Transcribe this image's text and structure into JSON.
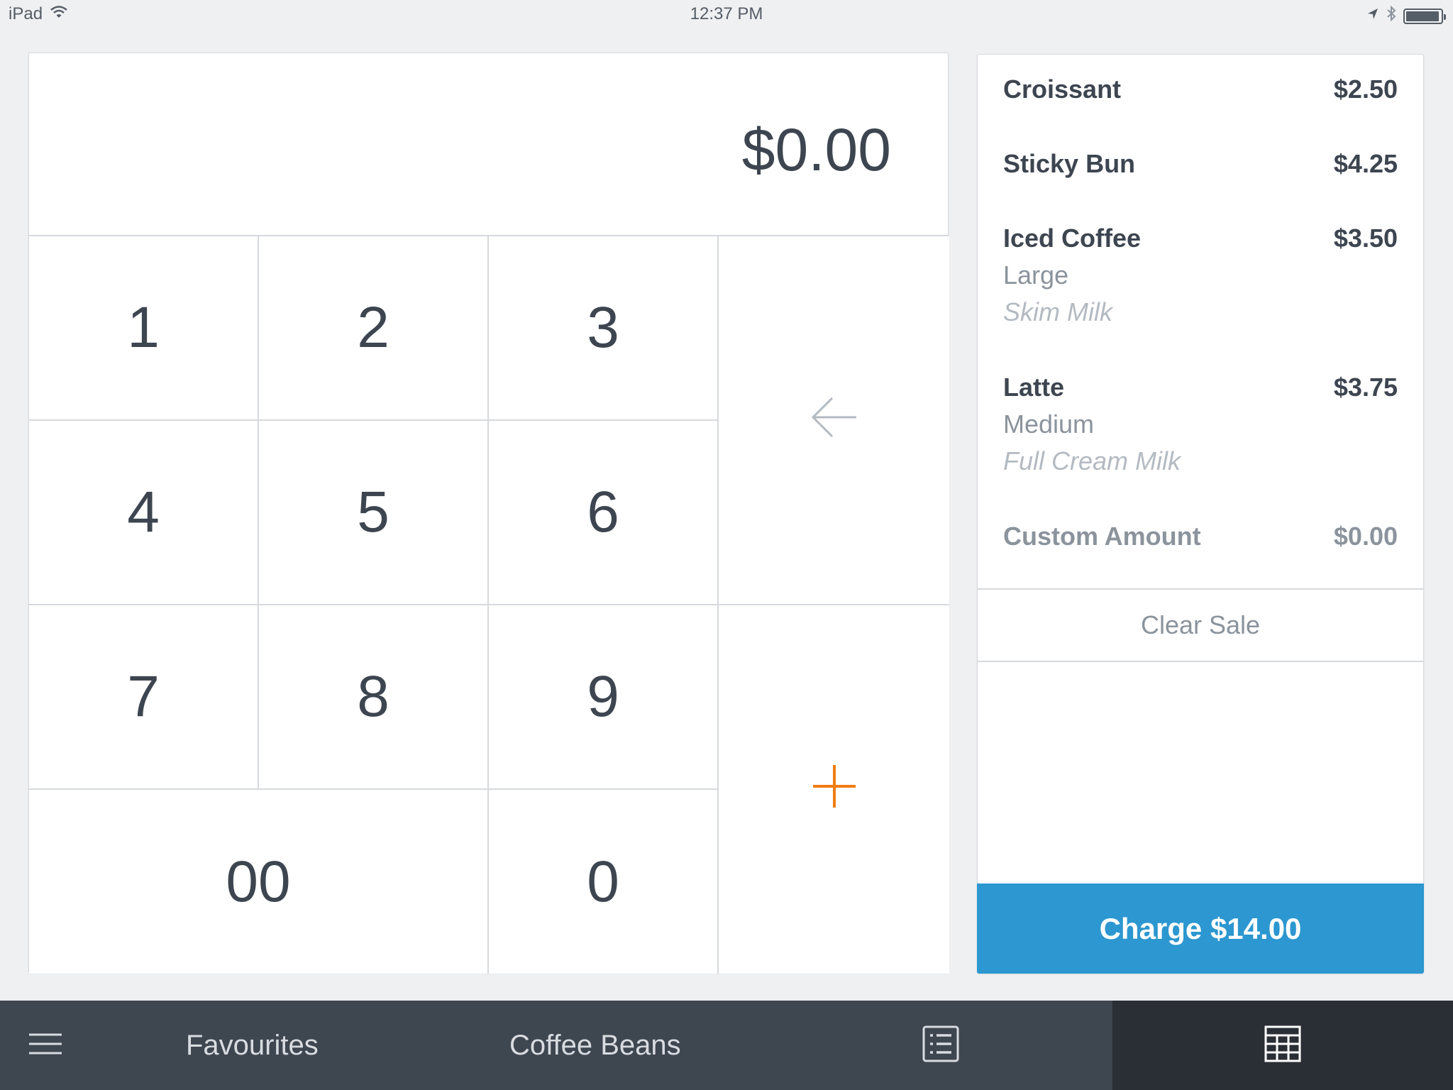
{
  "status_bar": {
    "device": "iPad",
    "time": "12:37 PM",
    "battery_level": 0.95
  },
  "keypad": {
    "amount": "$0.00",
    "keys": {
      "one": "1",
      "two": "2",
      "three": "3",
      "four": "4",
      "five": "5",
      "six": "6",
      "seven": "7",
      "eight": "8",
      "nine": "9",
      "double_zero": "00",
      "zero": "0"
    },
    "backspace_icon": "left-arrow-icon",
    "add_icon": "plus-icon"
  },
  "ticket": {
    "items": [
      {
        "name": "Croissant",
        "price": "$2.50"
      },
      {
        "name": "Sticky Bun",
        "price": "$4.25"
      },
      {
        "name": "Iced Coffee",
        "price": "$3.50",
        "modifier_1": "Large",
        "modifier_2": "Skim Milk"
      },
      {
        "name": "Latte",
        "price": "$3.75",
        "modifier_1": "Medium",
        "modifier_2": "Full Cream Milk"
      },
      {
        "name": "Custom Amount",
        "price": "$0.00"
      }
    ],
    "clear_sale": "Clear Sale",
    "charge": "Charge $14.00"
  },
  "tab_bar": {
    "tabs": [
      {
        "label": "Favourites"
      },
      {
        "label": "Coffee Beans"
      }
    ],
    "menu_icon": "hamburger-menu-icon",
    "library_icon": "item-list-icon",
    "keypad_icon": "keypad-grid-icon"
  },
  "colors": {
    "accent": "#2c97d0",
    "plus": "#f07d12",
    "tab_bar": "#3e4650",
    "tab_active": "#2a2f35"
  }
}
